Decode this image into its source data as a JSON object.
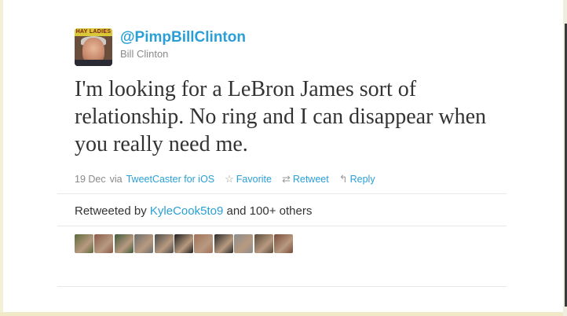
{
  "tweet": {
    "avatar_banner": "HAY LADIES",
    "handle": "@PimpBillClinton",
    "full_name": "Bill Clinton",
    "text": "I'm looking for a LeBron James sort of relationship. No ring and I can disappear when you really need me.",
    "date": "19 Dec",
    "via_label": "via",
    "source": "TweetCaster for iOS"
  },
  "actions": {
    "favorite": "Favorite",
    "retweet": "Retweet",
    "reply": "Reply"
  },
  "retweets": {
    "prefix": "Retweeted by",
    "user": "KyleCook5to9",
    "suffix": "and 100+ others",
    "avatar_colors": [
      "#5d6b3a",
      "#8a5a4a",
      "#3f5a3a",
      "#6d6d6d",
      "#4a4a4a",
      "#1e1e1e",
      "#a0705a",
      "#2a2a2a",
      "#8c8c8c",
      "#5a4a3a",
      "#7a4a3a"
    ]
  }
}
